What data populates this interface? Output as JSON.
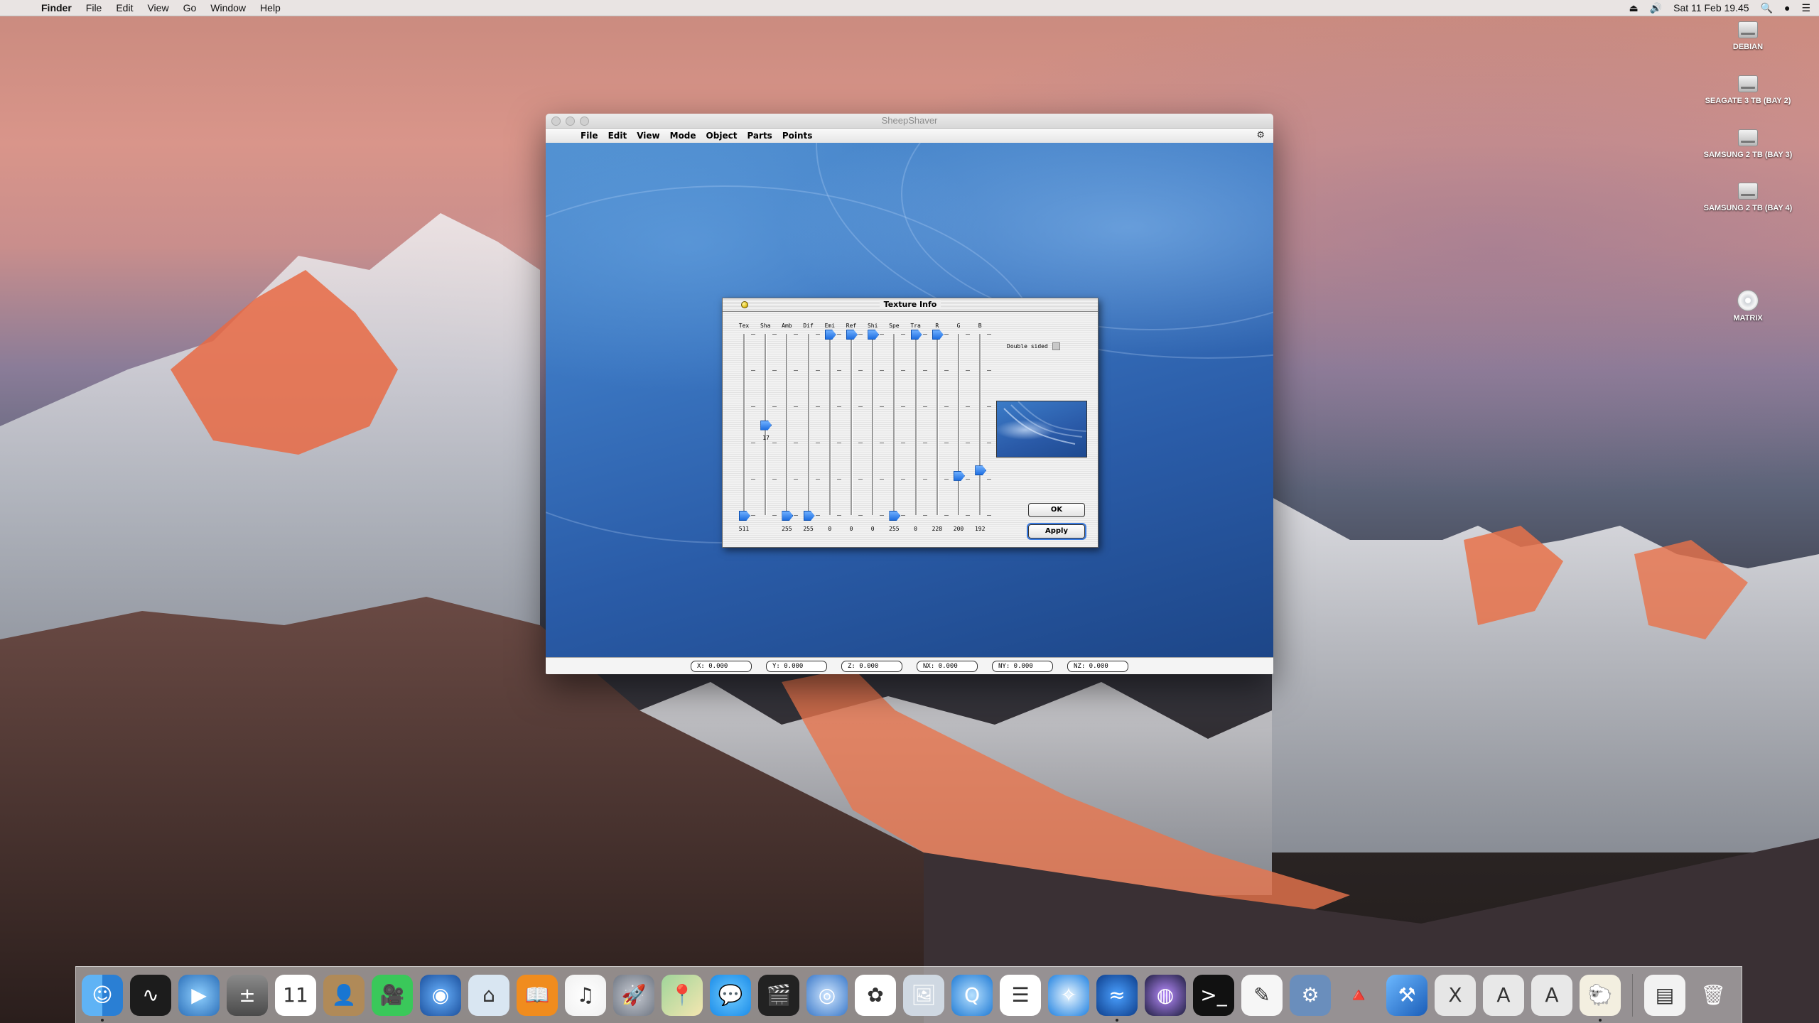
{
  "menubar": {
    "apple": "",
    "app_name": "Finder",
    "items": [
      "File",
      "Edit",
      "View",
      "Go",
      "Window",
      "Help"
    ],
    "clock": "Sat 11 Feb 19.45"
  },
  "desktop_icons": [
    {
      "label": "DEBIAN"
    },
    {
      "label": "SEAGATE 3 TB (BAY 2)"
    },
    {
      "label": "SAMSUNG 2 TB (BAY 3)"
    },
    {
      "label": "SAMSUNG 2 TB (BAY 4)"
    },
    {
      "label": "MATRIX"
    }
  ],
  "window": {
    "title": "SheepShaver",
    "menu": [
      "File",
      "Edit",
      "View",
      "Mode",
      "Object",
      "Parts",
      "Points"
    ],
    "status_fields": [
      "X: 0.000",
      "Y: 0.000",
      "Z: 0.000",
      "NX: 0.000",
      "NY: 0.000",
      "NZ: 0.000"
    ]
  },
  "dialog": {
    "title": "Texture Info",
    "double_sided_label": "Double sided",
    "double_sided_checked": false,
    "ok_label": "OK",
    "apply_label": "Apply",
    "sliders": [
      {
        "label": "Tex",
        "value": "511",
        "level": 0.0
      },
      {
        "label": "Sha",
        "value": "17",
        "level": 0.5
      },
      {
        "label": "Amb",
        "value": "255",
        "level": 0.0
      },
      {
        "label": "Dif",
        "value": "255",
        "level": 0.0
      },
      {
        "label": "Emi",
        "value": "0",
        "level": 1.0
      },
      {
        "label": "Ref",
        "value": "0",
        "level": 1.0
      },
      {
        "label": "Shi",
        "value": "0",
        "level": 1.0
      },
      {
        "label": "Spe",
        "value": "255",
        "level": 0.0
      },
      {
        "label": "Tra",
        "value": "0",
        "level": 1.0
      },
      {
        "label": "R",
        "value": "228",
        "level": 1.0
      },
      {
        "label": "G",
        "value": "200",
        "level": 0.22
      },
      {
        "label": "B",
        "value": "192",
        "level": 0.25
      }
    ]
  },
  "colors": {
    "accent": "#1f6fe0",
    "os9_desktop": "#2a5ca8"
  },
  "dock": [
    {
      "icon": "finder-icon",
      "running": true
    },
    {
      "icon": "activity-monitor-icon",
      "running": false
    },
    {
      "icon": "quicktime-icon",
      "running": false
    },
    {
      "icon": "calculator-icon",
      "running": false
    },
    {
      "icon": "calendar-icon",
      "running": false
    },
    {
      "icon": "contacts-icon",
      "running": false
    },
    {
      "icon": "facetime-icon",
      "running": false
    },
    {
      "icon": "google-earth-icon",
      "running": false
    },
    {
      "icon": "home-icon",
      "running": false
    },
    {
      "icon": "ibooks-icon",
      "running": false
    },
    {
      "icon": "itunes-icon",
      "running": false
    },
    {
      "icon": "launchpad-icon",
      "running": false
    },
    {
      "icon": "maps-icon",
      "running": false
    },
    {
      "icon": "messages-icon",
      "running": false
    },
    {
      "icon": "final-cut-icon",
      "running": false
    },
    {
      "icon": "network-icon",
      "running": false
    },
    {
      "icon": "photos-icon",
      "running": false
    },
    {
      "icon": "preview-icon",
      "running": false
    },
    {
      "icon": "quicktime-player-icon",
      "running": false
    },
    {
      "icon": "reminders-icon",
      "running": false
    },
    {
      "icon": "safari-icon",
      "running": false
    },
    {
      "icon": "sheepshaver-icon",
      "running": true
    },
    {
      "icon": "siri-icon",
      "running": false
    },
    {
      "icon": "terminal-icon",
      "running": false
    },
    {
      "icon": "textedit-icon",
      "running": false
    },
    {
      "icon": "utility-icon",
      "running": false
    },
    {
      "icon": "vlc-icon",
      "running": false
    },
    {
      "icon": "xcode-icon",
      "running": false
    },
    {
      "icon": "x11-icon",
      "running": false
    },
    {
      "icon": "app-store-icon",
      "running": false
    },
    {
      "icon": "app-store-2-icon",
      "running": false
    },
    {
      "icon": "sheep-icon",
      "running": true
    },
    {
      "icon": "documents-icon",
      "running": false
    },
    {
      "icon": "trash-icon",
      "running": false
    }
  ]
}
